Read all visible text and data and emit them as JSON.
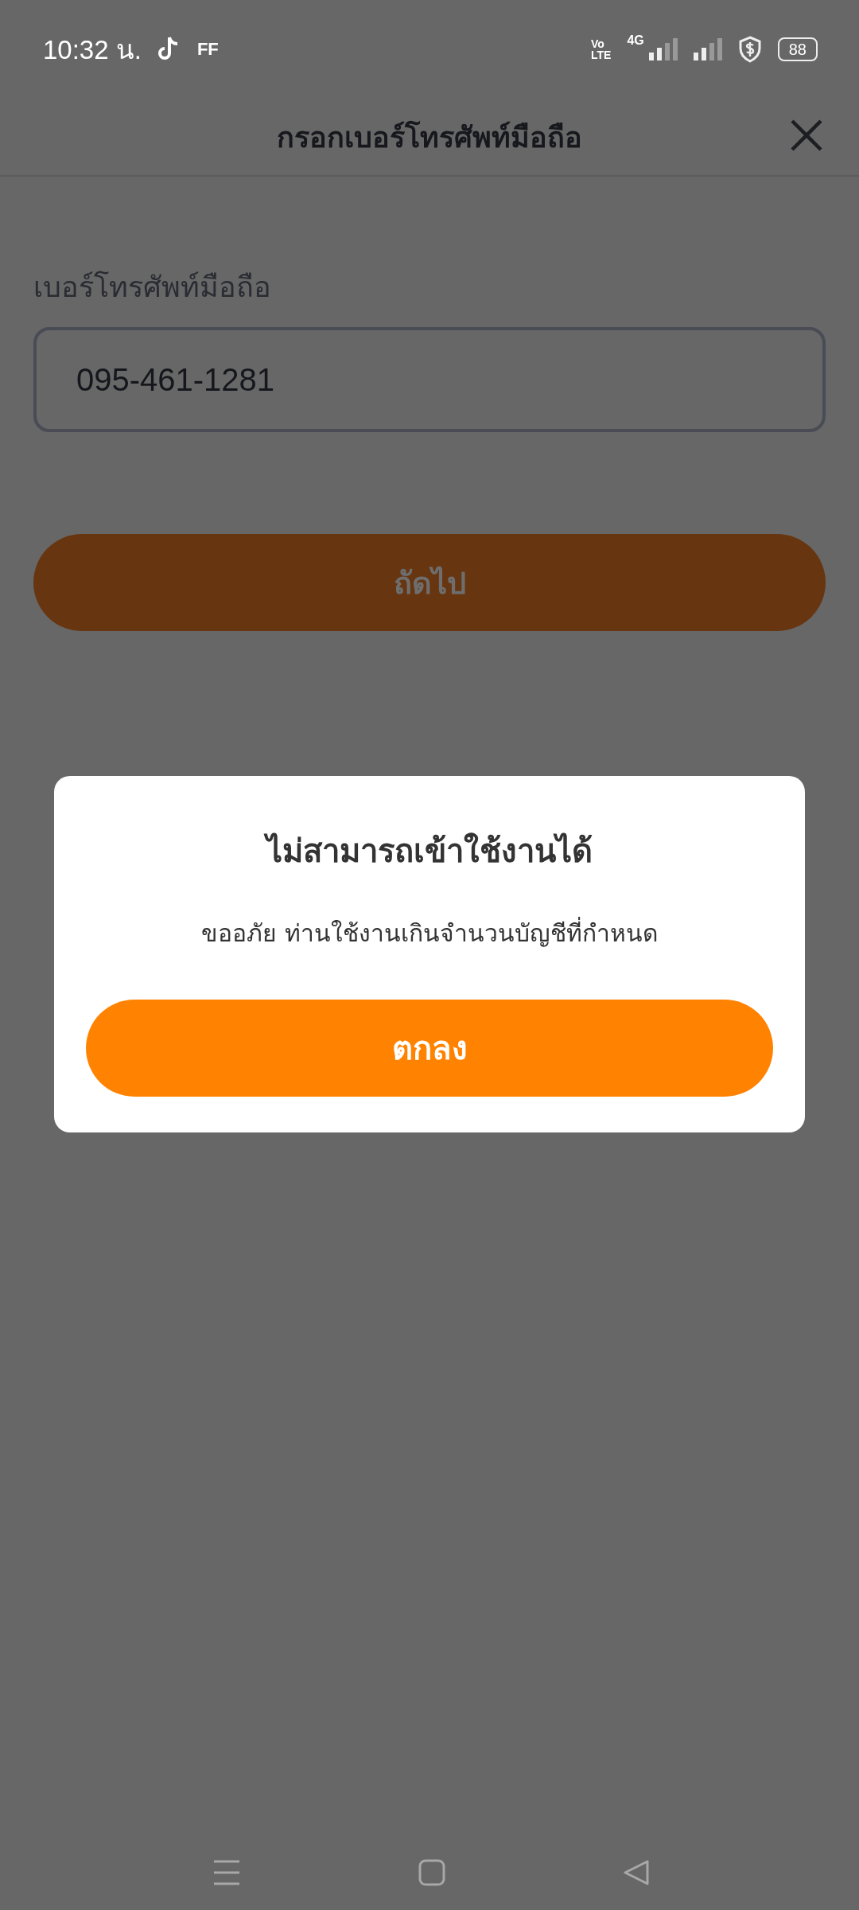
{
  "status_bar": {
    "time": "10:32 น.",
    "app_badge": "FF",
    "network_top": "Vo",
    "network_bottom": "LTE",
    "network_type": "4G",
    "battery": "88"
  },
  "header": {
    "title": "กรอกเบอร์โทรศัพท์มือถือ"
  },
  "form": {
    "label": "เบอร์โทรศัพท์มือถือ",
    "value": "095-461-1281",
    "button": {
      "label": "ถัดไป",
      "disabled": true
    }
  },
  "dialog": {
    "title": "ไม่สามารถเข้าใช้งานได้",
    "message": "ขออภัย ท่านใช้งานเกินจำนวนบัญชีที่กำหนด",
    "button": "ตกลง"
  }
}
